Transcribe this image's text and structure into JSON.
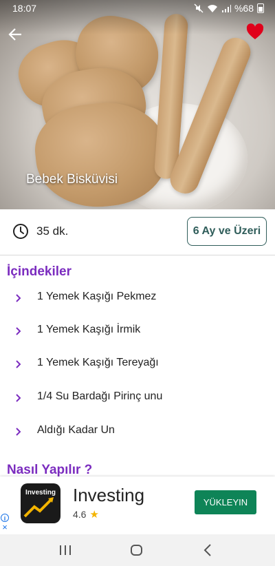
{
  "status_bar": {
    "time": "18:07",
    "battery": "%68"
  },
  "recipe": {
    "title": "Bebek Bisküvisi",
    "duration": "35 dk.",
    "age_group": "6 Ay ve Üzeri"
  },
  "ingredients": {
    "heading": "İçindekiler",
    "items": [
      "1 Yemek Kaşığı Pekmez",
      "1 Yemek Kaşığı İrmik",
      "1 Yemek Kaşığı Tereyağı",
      "1/4 Su Bardağı Pirinç unu",
      "Aldığı Kadar Un"
    ]
  },
  "instructions": {
    "heading": "Nasıl Yapılır ?"
  },
  "ad": {
    "logo_text": "Investing",
    "app_name": "Investing",
    "rating": "4.6",
    "cta": "YÜKLEYIN"
  },
  "colors": {
    "accent": "#7b2cbf",
    "age_border": "#2f5d5a",
    "favorite": "#e0001b",
    "ad_cta": "#0e8457"
  },
  "icons": {
    "back": "arrow-left-icon",
    "favorite": "heart-icon",
    "duration": "clock-icon",
    "list_bullet": "chevron-right-icon"
  }
}
